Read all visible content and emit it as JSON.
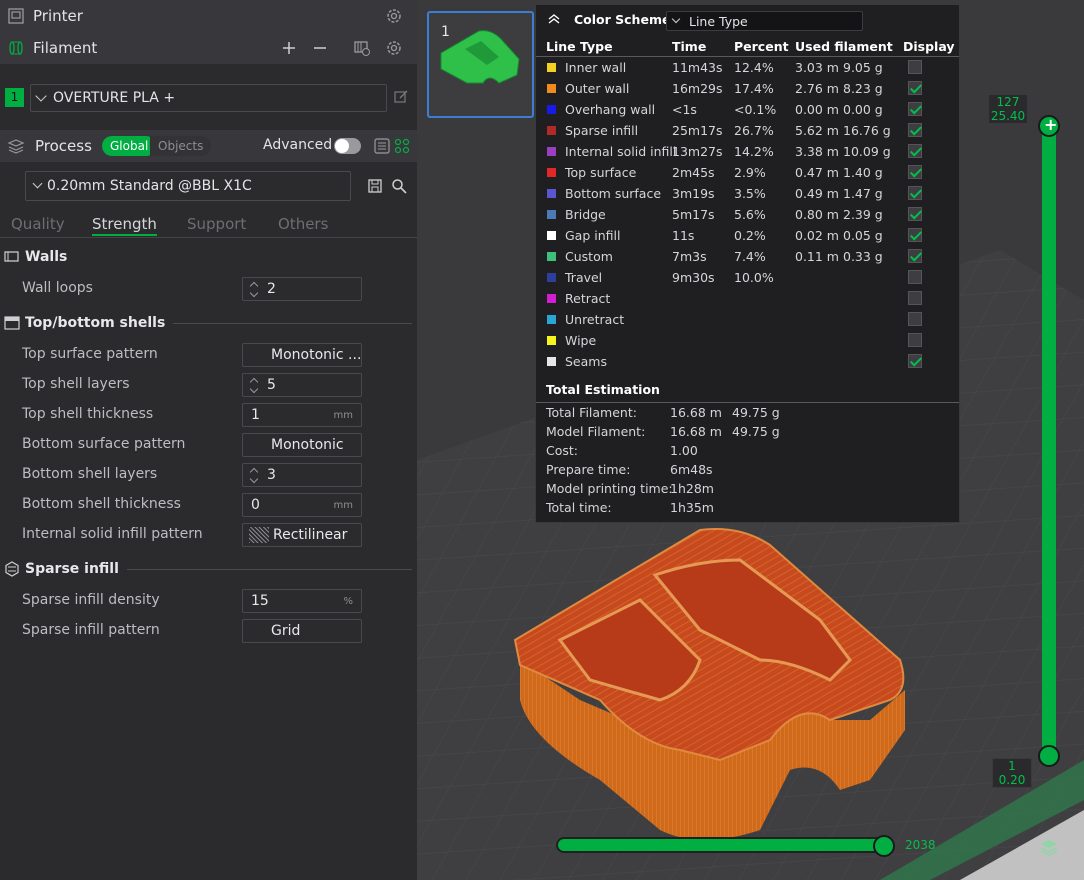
{
  "header": {
    "printer_label": "Printer",
    "filament_label": "Filament"
  },
  "filament": {
    "index": "1",
    "name": "OVERTURE PLA +"
  },
  "process": {
    "label": "Process",
    "global_label": "Global",
    "objects_label": "Objects",
    "advanced_label": "Advanced",
    "preset": "0.20mm Standard @BBL X1C"
  },
  "tabs": [
    "Quality",
    "Strength",
    "Support",
    "Others"
  ],
  "sections": {
    "walls": "Walls",
    "shells": "Top/bottom shells",
    "sparse": "Sparse infill"
  },
  "params": {
    "wall_loops": {
      "label": "Wall loops",
      "value": "2"
    },
    "top_surface_pattern": {
      "label": "Top surface pattern",
      "value": "Monotonic ..."
    },
    "top_shell_layers": {
      "label": "Top shell layers",
      "value": "5"
    },
    "top_shell_thickness": {
      "label": "Top shell thickness",
      "value": "1",
      "unit": "mm"
    },
    "bottom_surface_pattern": {
      "label": "Bottom surface pattern",
      "value": "Monotonic"
    },
    "bottom_shell_layers": {
      "label": "Bottom shell layers",
      "value": "3"
    },
    "bottom_shell_thickness": {
      "label": "Bottom shell thickness",
      "value": "0",
      "unit": "mm"
    },
    "internal_solid_pattern": {
      "label": "Internal solid infill pattern",
      "value": "Rectilinear"
    },
    "sparse_density": {
      "label": "Sparse infill density",
      "value": "15",
      "unit": "%"
    },
    "sparse_pattern": {
      "label": "Sparse infill pattern",
      "value": "Grid"
    }
  },
  "plate": {
    "number": "1"
  },
  "legend": {
    "title": "Color Scheme",
    "scheme": "Line Type",
    "columns": [
      "Line Type",
      "Time",
      "Percent",
      "Used filament",
      "Display"
    ],
    "rows": [
      {
        "name": "Inner wall",
        "color": "#f5d020",
        "time": "11m43s",
        "percent": "12.4%",
        "len": "3.03 m",
        "mass": "9.05 g",
        "on": false
      },
      {
        "name": "Outer wall",
        "color": "#f08c1e",
        "time": "16m29s",
        "percent": "17.4%",
        "len": "2.76 m",
        "mass": "8.23 g",
        "on": true
      },
      {
        "name": "Overhang wall",
        "color": "#1a1ae6",
        "time": "<1s",
        "percent": "<0.1%",
        "len": "0.00 m",
        "mass": "0.00 g",
        "on": true
      },
      {
        "name": "Sparse infill",
        "color": "#b02a2a",
        "time": "25m17s",
        "percent": "26.7%",
        "len": "5.62 m",
        "mass": "16.76 g",
        "on": true
      },
      {
        "name": "Internal solid infill",
        "color": "#9a3fbf",
        "time": "13m27s",
        "percent": "14.2%",
        "len": "3.38 m",
        "mass": "10.09 g",
        "on": true
      },
      {
        "name": "Top surface",
        "color": "#e02828",
        "time": "2m45s",
        "percent": "2.9%",
        "len": "0.47 m",
        "mass": "1.40 g",
        "on": true
      },
      {
        "name": "Bottom surface",
        "color": "#5a56d0",
        "time": "3m19s",
        "percent": "3.5%",
        "len": "0.49 m",
        "mass": "1.47 g",
        "on": true
      },
      {
        "name": "Bridge",
        "color": "#4a7ab8",
        "time": "5m17s",
        "percent": "5.6%",
        "len": "0.80 m",
        "mass": "2.39 g",
        "on": true
      },
      {
        "name": "Gap infill",
        "color": "#ffffff",
        "time": "11s",
        "percent": "0.2%",
        "len": "0.02 m",
        "mass": "0.05 g",
        "on": true
      },
      {
        "name": "Custom",
        "color": "#3cc07a",
        "time": "7m3s",
        "percent": "7.4%",
        "len": "0.11 m",
        "mass": "0.33 g",
        "on": true
      },
      {
        "name": "Travel",
        "color": "#2d3f9a",
        "time": "9m30s",
        "percent": "10.0%",
        "len": "",
        "mass": "",
        "on": false
      },
      {
        "name": "Retract",
        "color": "#d21ed2",
        "time": "",
        "percent": "",
        "len": "",
        "mass": "",
        "on": false
      },
      {
        "name": "Unretract",
        "color": "#29a6d6",
        "time": "",
        "percent": "",
        "len": "",
        "mass": "",
        "on": false
      },
      {
        "name": "Wipe",
        "color": "#f5f51e",
        "time": "",
        "percent": "",
        "len": "",
        "mass": "",
        "on": false
      },
      {
        "name": "Seams",
        "color": "#e6e6e6",
        "time": "",
        "percent": "",
        "len": "",
        "mass": "",
        "on": true
      }
    ],
    "total_title": "Total Estimation",
    "estimates": [
      {
        "label": "Total Filament:",
        "v1": "16.68 m",
        "v2": "49.75 g"
      },
      {
        "label": "Model Filament:",
        "v1": "16.68 m",
        "v2": "49.75 g"
      },
      {
        "label": "Cost:",
        "v1": "1.00",
        "v2": ""
      },
      {
        "label": "Prepare time:",
        "v1": "6m48s",
        "v2": ""
      },
      {
        "label": "Model printing time:",
        "v1": "1h28m",
        "v2": ""
      },
      {
        "label": "Total time:",
        "v1": "1h35m",
        "v2": ""
      }
    ]
  },
  "layer_slider": {
    "top_layer": "127",
    "top_height": "25.40",
    "bottom_layer": "1",
    "bottom_height": "0.20"
  },
  "move_slider": {
    "value": "2038"
  }
}
